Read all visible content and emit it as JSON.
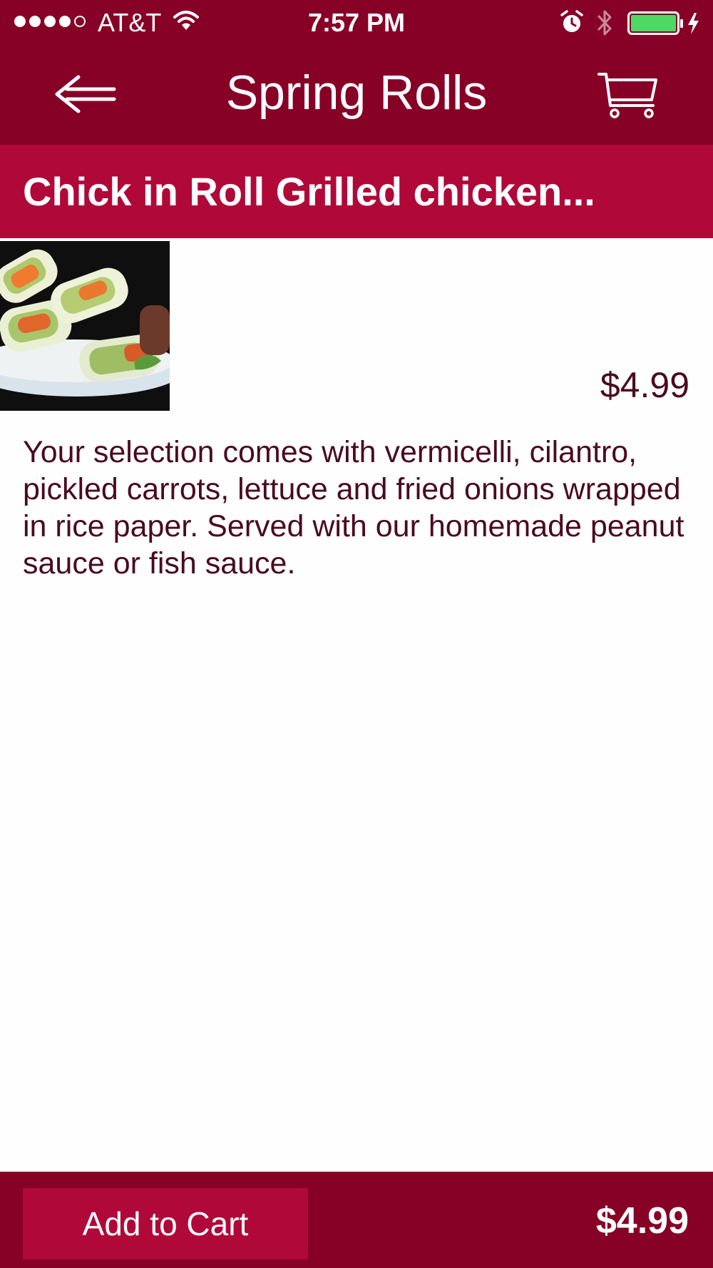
{
  "status_bar": {
    "signal_strength": "4 of 5",
    "carrier": "AT&T",
    "time": "7:57 PM",
    "icons": [
      "wifi-icon",
      "alarm-icon",
      "bluetooth-icon",
      "battery-icon",
      "charging-icon"
    ],
    "battery_color": "#4cd964"
  },
  "nav": {
    "title": "Spring Rolls",
    "back_icon": "arrow-left-icon",
    "cart_icon": "shopping-cart-icon"
  },
  "item": {
    "title": "Chick in Roll Grilled chicken...",
    "price": "$4.99",
    "description": "Your selection comes with vermicelli, cilantro, pickled carrots, lettuce and fried onions wrapped in rice paper. Served with our homemade peanut sauce or fish sauce."
  },
  "footer": {
    "add_to_cart_label": "Add to Cart",
    "total": "$4.99"
  },
  "colors": {
    "primary": "#870026",
    "accent": "#b00939",
    "text": "#4a0a20",
    "background": "#fefefe"
  }
}
